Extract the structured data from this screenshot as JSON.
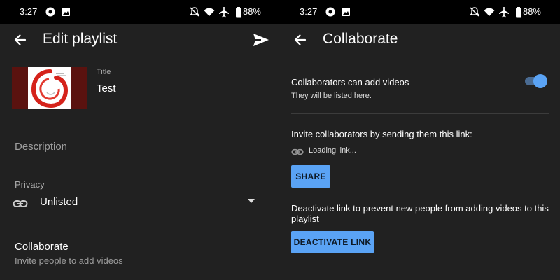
{
  "status_bar": {
    "time": "3:27",
    "battery": "88%"
  },
  "left": {
    "appbar": {
      "title": "Edit playlist"
    },
    "title_field": {
      "label": "Title",
      "value": "Test"
    },
    "description_field": {
      "placeholder": "Description"
    },
    "privacy": {
      "label": "Privacy",
      "value": "Unlisted"
    },
    "collaborate": {
      "title": "Collaborate",
      "subtitle": "Invite people to add videos"
    }
  },
  "right": {
    "appbar": {
      "title": "Collaborate"
    },
    "toggle": {
      "label": "Collaborators can add videos",
      "subtitle": "They will be listed here.",
      "on": true
    },
    "invite_text": "Invite collaborators by sending them this link:",
    "loading_text": "Loading link...",
    "share_label": "SHARE",
    "deactivate_text": "Deactivate link to prevent new people from adding videos to this playlist",
    "deactivate_label": "DEACTIVATE LINK"
  },
  "colors": {
    "accent": "#5aa3f5",
    "background": "#212121",
    "statusbar": "#000000"
  }
}
